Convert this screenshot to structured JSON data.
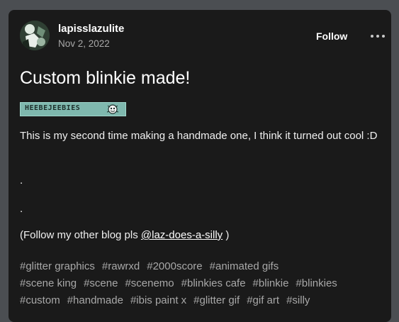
{
  "post": {
    "username": "lapisslazulite",
    "date": "Nov 2, 2022",
    "follow_label": "Follow",
    "title": "Custom blinkie made!",
    "blinkie": {
      "text": "HEEBEJEEBIES",
      "colors": {
        "background": "#7fb8ae",
        "text": "#1c2e2a"
      }
    },
    "paragraphs": [
      "This is my second time making a handmade one, I think it turned out cool :D",
      ".",
      "."
    ],
    "follow_line": {
      "prefix": "(Follow my other blog pls ",
      "mention": "@laz-does-a-silly",
      "suffix": " )"
    },
    "tag_rows": [
      [
        "#glitter graphics",
        "#rawrxd",
        "#2000score",
        "#animated gifs"
      ],
      [
        "#scene king",
        "#scene",
        "#scenemo",
        "#blinkies cafe",
        "#blinkie",
        "#blinkies"
      ],
      [
        "#custom",
        "#handmade",
        "#ibis paint x",
        "#glitter gif",
        "#gif art",
        "#silly"
      ]
    ]
  },
  "icons": {
    "more": "more-options-icon",
    "avatar": "avatar-image"
  },
  "colors": {
    "page_background": "#4b4e52",
    "card_background": "#1a1a1a",
    "muted_text": "#a8a8a8"
  }
}
